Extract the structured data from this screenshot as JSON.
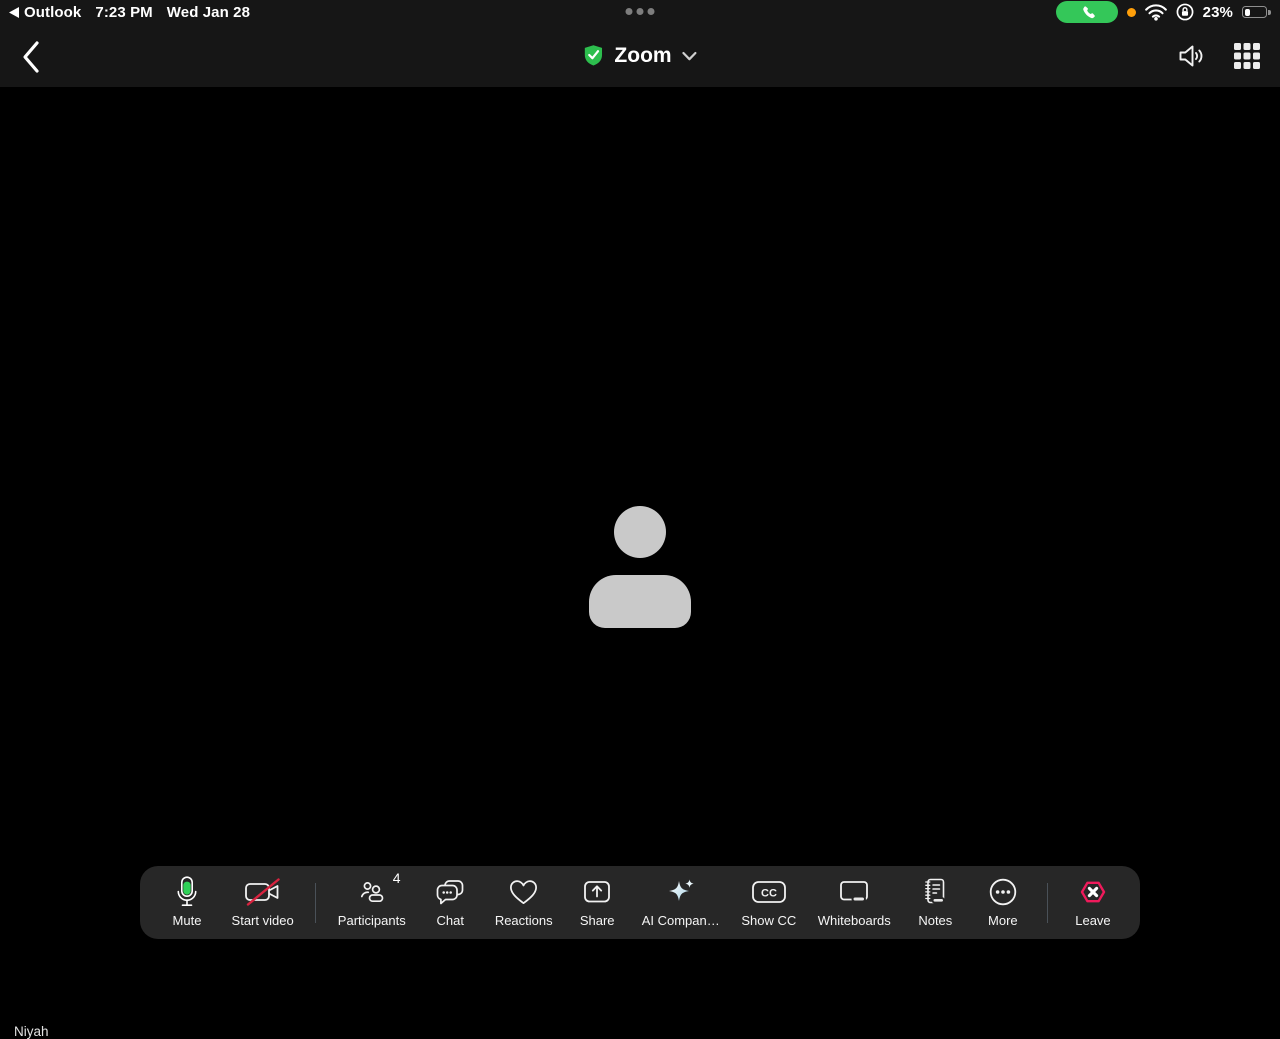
{
  "status_bar": {
    "back_app_label": "Outlook",
    "time": "7:23 PM",
    "date": "Wed Jan 28",
    "battery_percent_label": "23%",
    "icons": [
      "back-triangle-icon",
      "active-call-phone-icon",
      "microphone-in-use-dot",
      "wifi-icon",
      "rotation-lock-icon",
      "battery-icon"
    ]
  },
  "nav_bar": {
    "meeting_title": "Zoom",
    "icons": [
      "back-chevron-icon",
      "security-shield-icon",
      "chevron-down-icon",
      "speaker-icon",
      "apps-grid-icon"
    ]
  },
  "participant": {
    "name_label": "Niyah"
  },
  "toolbar": {
    "items": [
      {
        "label": "Mute",
        "icon": "microphone-icon"
      },
      {
        "label": "Start video",
        "icon": "video-camera-off-icon"
      },
      {
        "label": "Participants",
        "icon": "participants-icon",
        "badge": "4"
      },
      {
        "label": "Chat",
        "icon": "chat-bubbles-icon"
      },
      {
        "label": "Reactions",
        "icon": "heart-icon"
      },
      {
        "label": "Share",
        "icon": "share-screen-icon"
      },
      {
        "label": "AI Compan…",
        "icon": "ai-sparkle-icon"
      },
      {
        "label": "Show CC",
        "icon": "closed-captions-icon",
        "icon_text": "CC"
      },
      {
        "label": "Whiteboards",
        "icon": "whiteboard-icon"
      },
      {
        "label": "Notes",
        "icon": "notes-icon"
      },
      {
        "label": "More",
        "icon": "more-ellipsis-icon"
      },
      {
        "label": "Leave",
        "icon": "leave-hexagon-icon"
      }
    ]
  },
  "colors": {
    "mic_active_green": "#30d158",
    "video_slash_red": "#d8233f",
    "leave_pink": "#ef1a5b",
    "call_pill_green": "#34c759",
    "mic_in_use_orange": "#ff9f0a",
    "security_shield_green": "#2dbe4e",
    "ai_companion_blue": "#a9d3e6",
    "avatar_gray": "#c9c9c9"
  }
}
